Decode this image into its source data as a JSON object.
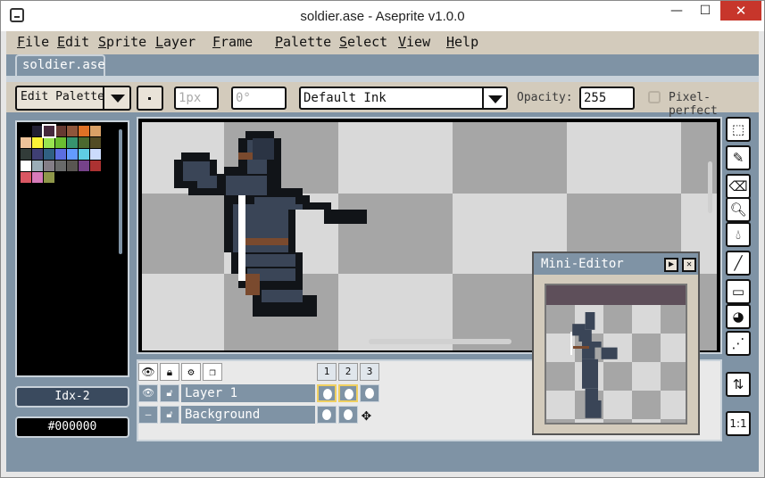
{
  "window": {
    "title": "soldier.ase - Aseprite v1.0.0",
    "minimize_symbol": "—",
    "maximize_symbol": "☐",
    "close_symbol": "✕"
  },
  "menu": [
    {
      "label": "File",
      "key": "F",
      "rest": "ile"
    },
    {
      "label": "Edit",
      "key": "E",
      "rest": "dit"
    },
    {
      "label": "Sprite",
      "key": "S",
      "rest": "prite"
    },
    {
      "label": "Layer",
      "key": "L",
      "rest": "ayer"
    },
    {
      "label": "Frame",
      "key": "F",
      "rest": "rame"
    },
    {
      "label": "Palette",
      "key": "P",
      "rest": "alette"
    },
    {
      "label": "Select",
      "key": "S",
      "rest": "elect"
    },
    {
      "label": "View",
      "key": "V",
      "rest": "iew"
    },
    {
      "label": "Help",
      "key": "H",
      "rest": "elp"
    }
  ],
  "tab": {
    "label": "soldier.ase"
  },
  "toolbar": {
    "edit_palette_label": "Edit Palette",
    "brush_size": "1px",
    "brush_angle": "0°",
    "ink_label": "Default Ink",
    "opacity_label": "Opacity:",
    "opacity_value": "255",
    "pixel_perfect_label": "Pixel-perfect"
  },
  "palette": {
    "colors": [
      "#000000",
      "#222034",
      "#45283c",
      "#663931",
      "#8f563b",
      "#df7126",
      "#d9a066",
      "#eec39a",
      "#fbf236",
      "#99e550",
      "#6abe30",
      "#37946e",
      "#4b692f",
      "#524b24",
      "#323c39",
      "#3f3f74",
      "#306082",
      "#5b6ee1",
      "#639bff",
      "#5fcde4",
      "#cbdbfc",
      "#ffffff",
      "#9badb7",
      "#847e87",
      "#696a6a",
      "#595652",
      "#76428a",
      "#ac3232",
      "#d95763",
      "#d77bba",
      "#8f974a"
    ],
    "selected_index": 2,
    "index_label": "Idx-2",
    "hex_label": "#000000"
  },
  "timeline": {
    "header_icons": [
      "eye-icon",
      "lock-icon",
      "gear-icon",
      "layers-icon"
    ],
    "frames": [
      "1",
      "2",
      "3"
    ],
    "layers": [
      {
        "name": "Layer 1",
        "visible": true,
        "locked": false
      },
      {
        "name": "Background",
        "visible": false,
        "locked": false
      }
    ]
  },
  "mini_editor": {
    "title": "Mini-Editor",
    "play_symbol": "▶",
    "close_symbol": "✕"
  },
  "tools": [
    {
      "name": "rectangular-marquee-icon",
      "glyph": "⬚"
    },
    {
      "name": "pencil-icon",
      "glyph": "✎"
    },
    {
      "name": "eraser-icon",
      "glyph": "⌫"
    },
    {
      "name": "zoom-icon",
      "glyph": "🔍︎"
    },
    {
      "name": "eyedropper-icon",
      "glyph": "💧︎"
    },
    {
      "name": "line-icon",
      "glyph": "╱"
    },
    {
      "name": "rectangle-icon",
      "glyph": "▭"
    },
    {
      "name": "fill-icon",
      "glyph": "◕"
    },
    {
      "name": "spray-icon",
      "glyph": "⋰"
    },
    {
      "name": "sort-icon",
      "glyph": "⇅"
    },
    {
      "name": "zoom-1to1-icon",
      "glyph": "1:1"
    }
  ],
  "colors": {
    "app_bg": "#7f93a5",
    "menu_bg": "#d3cbbc",
    "accent_border": "#c9d2da",
    "close_red": "#c7362b",
    "checker_light": "#d9d9d9",
    "checker_dark": "#a6a6a6"
  }
}
